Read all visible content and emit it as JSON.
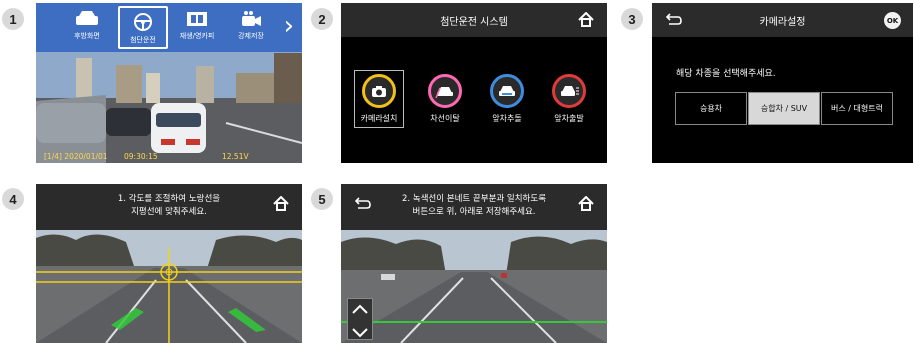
{
  "step_numbers": [
    "1",
    "2",
    "3",
    "4",
    "5"
  ],
  "screen1": {
    "menu": [
      {
        "label": "후방화면",
        "icon": "car-rear-icon"
      },
      {
        "label": "첨단운전",
        "icon": "steering-wheel-icon"
      },
      {
        "label": "재생/영카피",
        "icon": "film-icon"
      },
      {
        "label": "강제저장",
        "icon": "camera-icon"
      }
    ],
    "selected_index": 1,
    "status": {
      "left": "[1/4] 2020/01/01",
      "time": "09:30:15",
      "voltage": "12.51V"
    }
  },
  "screen2": {
    "title": "첨단운전 시스템",
    "items": [
      {
        "label": "카메라설치",
        "icon": "camera-icon",
        "ring_color": "#f2c01a"
      },
      {
        "label": "차선이탈",
        "icon": "lane-car-icon",
        "ring_color": "#ff69b4"
      },
      {
        "label": "앞차추돌",
        "icon": "front-collision-icon",
        "ring_color": "#3d8de0"
      },
      {
        "label": "앞차출발",
        "icon": "front-departure-icon",
        "ring_color": "#e23b3b"
      }
    ],
    "selected_index": 0
  },
  "screen3": {
    "title": "카메라설정",
    "ok_label": "OK",
    "question": "해당 차종을 선택해주세요.",
    "options": [
      "승용차",
      "승합차 / SUV",
      "버스 / 대형트럭"
    ],
    "selected_index": 1
  },
  "screen4": {
    "instruction_line1": "1. 각도를 조절하여 노랑선을",
    "instruction_line2": "지평선에 맞춰주세요."
  },
  "screen5": {
    "instruction_line1": "2. 녹색선이 본네트 끝부분과 일치하도록",
    "instruction_line2": "버튼으로 위, 아래로 저장해주세요."
  },
  "colors": {
    "menu_blue": "#3d6ec2",
    "header_gray": "#2b2b2b",
    "guide_yellow": "#f2d21a",
    "guide_green": "#34c83a",
    "status_yellow": "#ffd84a"
  }
}
